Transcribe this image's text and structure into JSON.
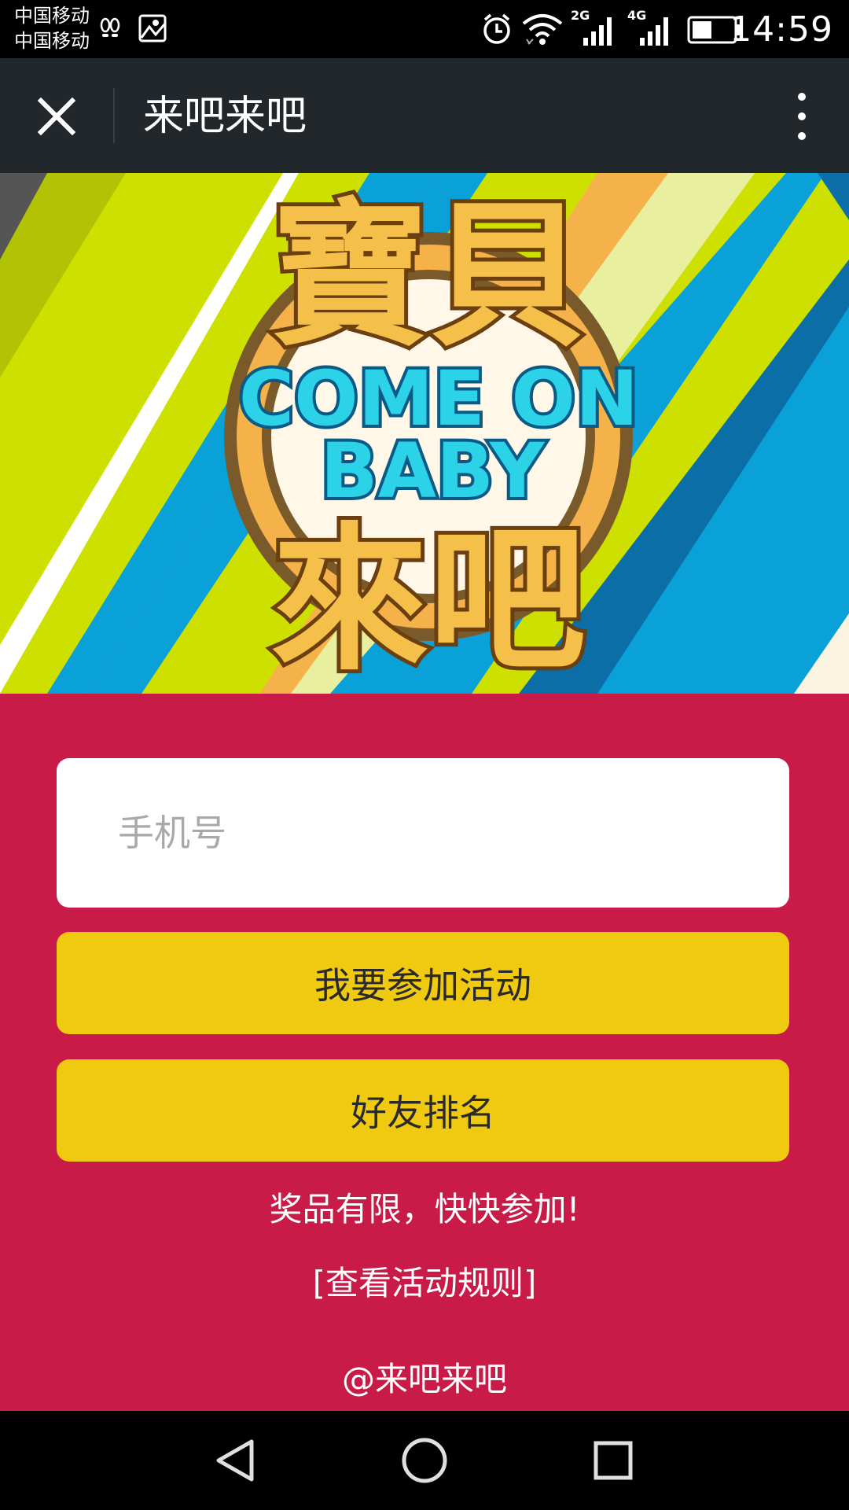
{
  "status_bar": {
    "carrier_1": "中国移动",
    "carrier_2": "中国移动",
    "network_1": "2G",
    "network_2": "4G",
    "time": "14:59"
  },
  "title_bar": {
    "title": "来吧来吧"
  },
  "banner": {
    "logo_top": "寶貝",
    "logo_mid_1": "COME ON",
    "logo_mid_2": "BABY",
    "logo_bottom": "來吧"
  },
  "form": {
    "phone_placeholder": "手机号",
    "join_label": "我要参加活动",
    "ranking_label": "好友排名"
  },
  "promo_text": "奖品有限，快快参加!",
  "rules_link": "[查看活动规则]",
  "footer": "@来吧来吧",
  "colors": {
    "page_red": "#c81b48",
    "button_yellow": "#f0ca10",
    "title_bar": "#22272b"
  }
}
